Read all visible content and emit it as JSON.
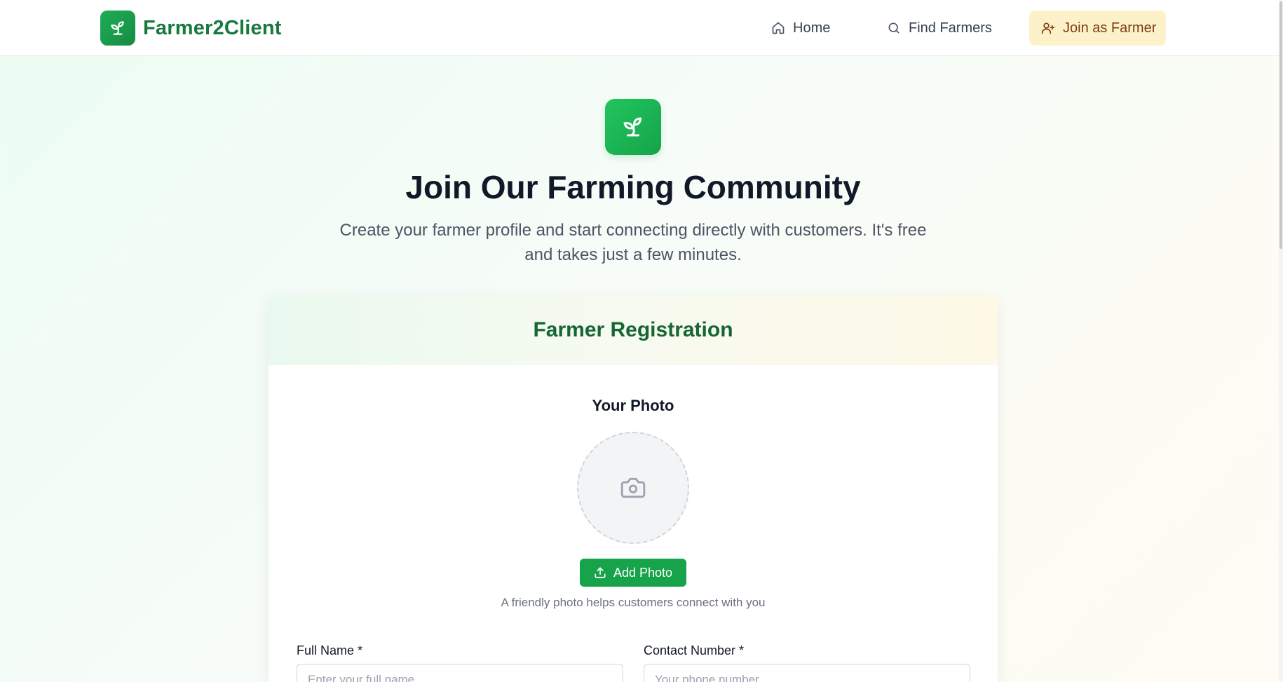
{
  "brand": {
    "name": "Farmer2Client",
    "logo_icon": "sprout-icon"
  },
  "nav": {
    "home": {
      "label": "Home",
      "icon": "home-icon"
    },
    "find": {
      "label": "Find Farmers",
      "icon": "search-icon"
    },
    "join": {
      "label": "Join as Farmer",
      "icon": "user-plus-icon"
    }
  },
  "hero": {
    "icon": "sprout-icon",
    "title": "Join Our Farming Community",
    "subtitle": "Create your farmer profile and start connecting directly with customers. It's free and takes just a few minutes."
  },
  "form": {
    "title": "Farmer Registration",
    "photo": {
      "label": "Your Photo",
      "placeholder_icon": "camera-icon",
      "button_label": "Add Photo",
      "button_icon": "upload-icon",
      "hint": "A friendly photo helps customers connect with you"
    },
    "fields": {
      "full_name": {
        "label": "Full Name *",
        "placeholder": "Enter your full name",
        "value": ""
      },
      "contact": {
        "label": "Contact Number *",
        "placeholder": "Your phone number",
        "value": ""
      }
    }
  },
  "colors": {
    "brand_green": "#177a3d",
    "accent_green": "#16a34a",
    "join_bg": "#fdf1c9",
    "join_text": "#7c3d12"
  }
}
